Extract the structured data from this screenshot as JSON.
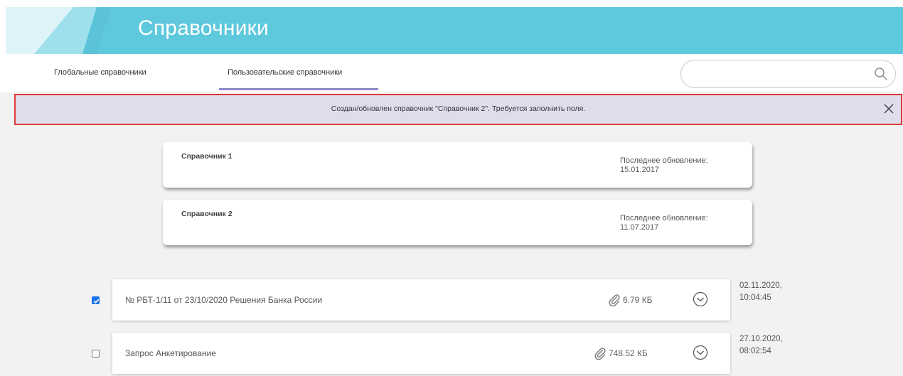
{
  "header": {
    "title": "Справочники"
  },
  "tabs": [
    {
      "label": "Глобальные справочники",
      "active": false
    },
    {
      "label": "Пользовательские справочники",
      "active": true
    }
  ],
  "search": {
    "placeholder": "",
    "value": "",
    "icon": "search-icon"
  },
  "notification": {
    "text": "Создан/обновлен справочник \"Справочник 2\". Требуется заполнить поля.",
    "close_icon": "close-icon"
  },
  "directories": [
    {
      "title": "Справочник 1",
      "updated_label": "Последнее обновление:",
      "updated_date": "15.01.2017"
    },
    {
      "title": "Справочник 2",
      "updated_label": "Последнее обновление:",
      "updated_date": "11.07.2017"
    }
  ],
  "documents": [
    {
      "checked": true,
      "title": "№ РБТ-1/11 от 23/10/2020 Решения Банка России",
      "size": "6.79 КБ",
      "date": "02.11.2020,",
      "time": "10:04:45"
    },
    {
      "checked": false,
      "title": "Запрос Анкетирование",
      "size": "748.52 КБ",
      "date": "27.10.2020,",
      "time": "08:02:54"
    }
  ],
  "colors": {
    "header_bg": "#5ec8dd",
    "tab_underline": "#8e86c4",
    "notice_bg": "#dfdcec",
    "notice_border": "#e03838",
    "checkbox_checked": "#1a73e8"
  }
}
